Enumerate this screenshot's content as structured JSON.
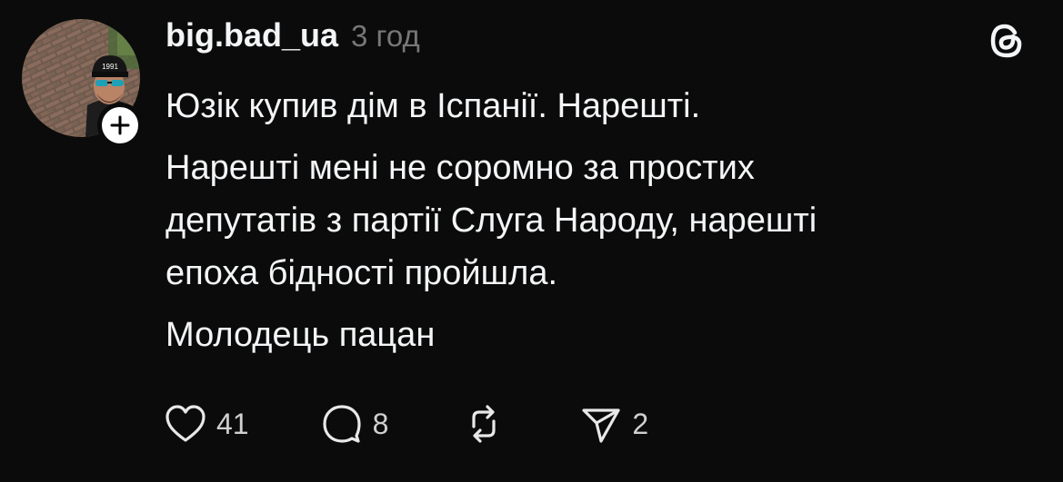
{
  "post": {
    "username": "big.bad_ua",
    "timestamp": "3 год",
    "paragraphs": [
      "Юзік купив дім в Іспанії. Нарешті.",
      "Нарешті мені не соромно за простих\nдепутатів з партії Слуга Народу, нарешті\nепоха бідності пройшла.",
      "Молодець пацан"
    ],
    "avatar_cap_text": "1991",
    "actions": {
      "likes": "41",
      "replies": "8",
      "reposts": "",
      "shares": "2"
    }
  },
  "icons": {
    "follow": "plus-icon",
    "logo": "threads-logo-icon",
    "like": "heart-icon",
    "reply": "comment-bubble-icon",
    "repost": "repost-arrows-icon",
    "share": "send-paper-plane-icon"
  },
  "colors": {
    "background": "#0b0b0b",
    "text": "#f3f5f7",
    "muted": "#777777"
  }
}
